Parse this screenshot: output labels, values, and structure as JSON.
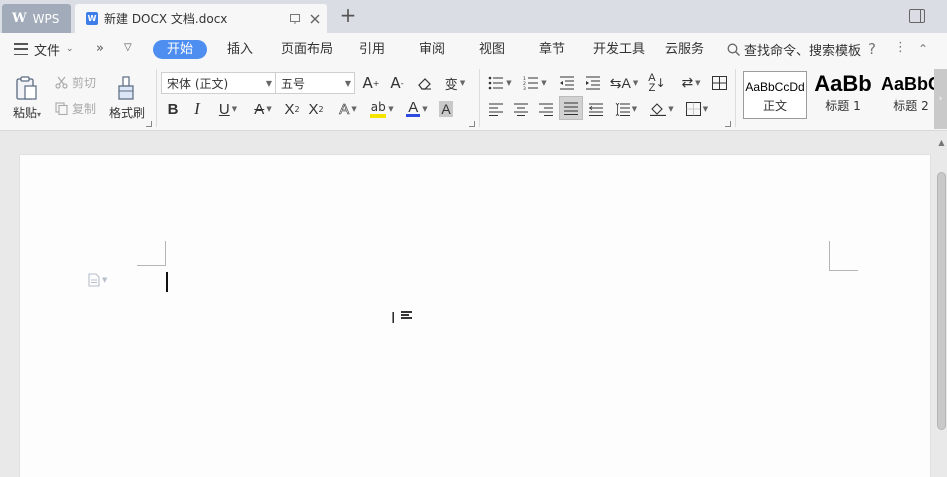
{
  "tabs": {
    "home_label": "WPS",
    "doc_title": "新建 DOCX 文档.docx",
    "new_tab": "+"
  },
  "menu": {
    "file": "文件",
    "tabs": [
      "开始",
      "插入",
      "页面布局",
      "引用",
      "审阅",
      "视图",
      "章节",
      "开发工具",
      "云服务"
    ],
    "active_tab": "开始",
    "search": "查找命令、搜索模板",
    "help": "?"
  },
  "ribbon": {
    "paste": "粘贴",
    "cut": "剪切",
    "copy": "复制",
    "format_painter": "格式刷",
    "font_name": "宋体 (正文)",
    "font_size": "五号",
    "bold": "B",
    "italic": "I",
    "underline": "U",
    "strike": "A",
    "superscript": "X",
    "subscript": "X",
    "styles": [
      {
        "sample": "AaBbCcDd",
        "name": "正文"
      },
      {
        "sample": "AaBb",
        "name": "标题 1"
      },
      {
        "sample": "AaBbC",
        "name": "标题 2"
      }
    ]
  },
  "colors": {
    "accent": "#4e8ef0",
    "highlight": "#f4e400",
    "font_color": "#2d4be0"
  }
}
